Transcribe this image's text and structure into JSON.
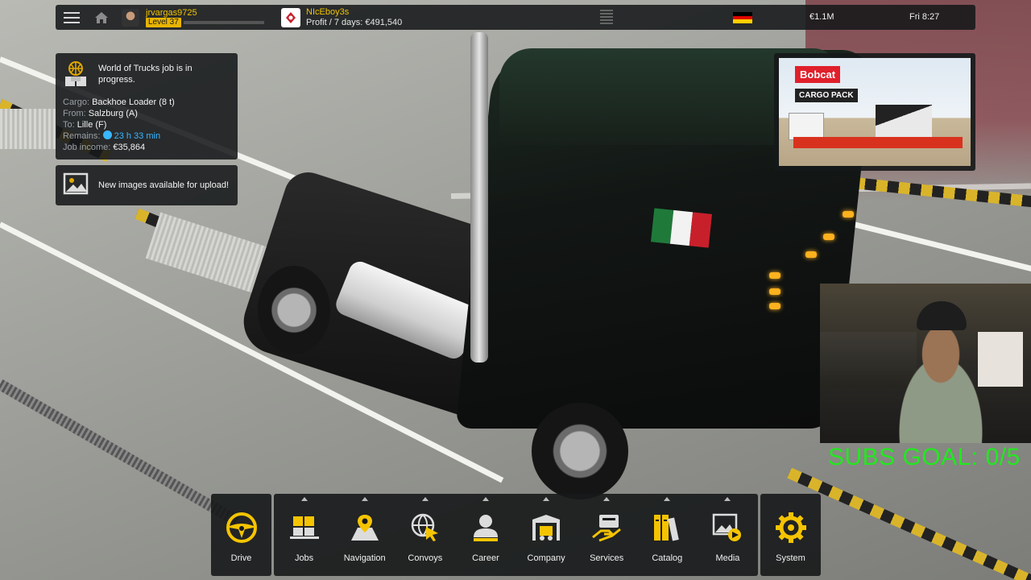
{
  "topbar": {
    "username": "jrvargas9725",
    "level": "Level 37",
    "company_name": "NIcEboy3s",
    "profit": "Profit / 7 days: €491,540",
    "money": "€1.1M",
    "time": "Fri 8:27",
    "icons": [
      "hamburger-menu-icon",
      "home-icon",
      "germany-flag-icon"
    ]
  },
  "job_notice": {
    "title": "World of Trucks job is in progress.",
    "rows": [
      {
        "label": "Cargo:",
        "value": "Backhoe Loader (8 t)"
      },
      {
        "label": "From:",
        "value": "Salzburg (A)"
      },
      {
        "label": "To:",
        "value": "Lille (F)"
      },
      {
        "label": "Remains:",
        "value": "23 h 33 min"
      },
      {
        "label": "Job income:",
        "value": "€35,864"
      }
    ]
  },
  "image_notice": {
    "text": "New images available for upload!"
  },
  "ad": {
    "brand": "Bobcat",
    "title": "CARGO PACK"
  },
  "overlay": {
    "subs_goal": "SUBS GOAL: 0/5"
  },
  "menu": {
    "drive": {
      "label": "Drive",
      "icon": "steering-wheel-icon"
    },
    "items": [
      {
        "label": "Jobs",
        "icon": "jobs-icon"
      },
      {
        "label": "Navigation",
        "icon": "map-pin-icon"
      },
      {
        "label": "Convoys",
        "icon": "globe-cursor-icon"
      },
      {
        "label": "Career",
        "icon": "person-icon"
      },
      {
        "label": "Company",
        "icon": "truck-garage-icon"
      },
      {
        "label": "Services",
        "icon": "services-icon"
      },
      {
        "label": "Catalog",
        "icon": "books-icon"
      },
      {
        "label": "Media",
        "icon": "media-icon"
      }
    ],
    "system": {
      "label": "System",
      "icon": "gear-icon"
    }
  },
  "colors": {
    "accent": "#f0c400",
    "remaining_time": "#39b6ff",
    "subs_text": "#22e81f",
    "panel_bg": "#16181a"
  }
}
